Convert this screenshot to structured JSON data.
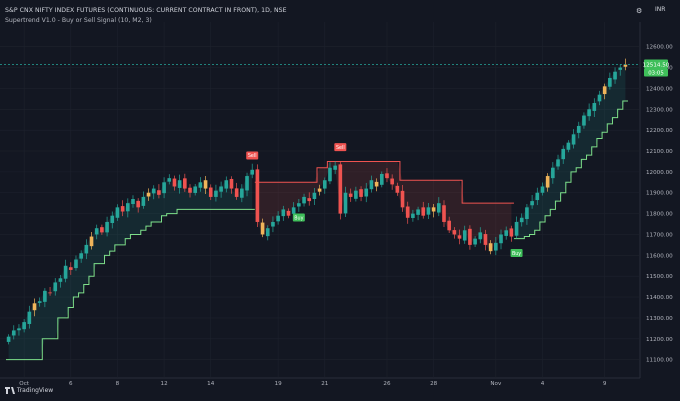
{
  "header": {
    "symbol_title": "S&P CNX NIFTY INDEX FUTURES (CONTINUOUS: CURRENT CONTRACT IN FRONT), 1D, NSE",
    "indicator_title": "Supertrend V1.0 - Buy or Sell Signal (10, M2, 3)",
    "currency": "INR",
    "settings_icon": "gear-icon"
  },
  "footer": {
    "brand": "TradingView",
    "brand_icon": "tradingview-logo-icon"
  },
  "colors": {
    "background": "#131722",
    "candle_up": "#26a69a",
    "candle_down": "#ef5350",
    "candle_highlight": "#f0b45a",
    "trend_up": "#7ee08a",
    "trend_down": "#ef5350",
    "buy_label": "#3fbf5a",
    "sell_label": "#ef5350",
    "axis_text": "#b2b5be"
  },
  "chart_data": {
    "type": "candlestick",
    "y_axis_ticks": [
      "12600.00",
      "12500.00",
      "12400.00",
      "12300.00",
      "12200.00",
      "12100.00",
      "12000.00",
      "11900.00",
      "11800.00",
      "11700.00",
      "11600.00",
      "11500.00",
      "11400.00",
      "11300.00",
      "11200.00",
      "11100.00"
    ],
    "y_axis_values": [
      12600,
      12500,
      12400,
      12300,
      12200,
      12100,
      12000,
      11900,
      11800,
      11700,
      11600,
      11500,
      11400,
      11300,
      11200,
      11100
    ],
    "ylim": [
      11060,
      12680
    ],
    "x_axis_labels": [
      {
        "text": "Oct",
        "bar": 3
      },
      {
        "text": "6",
        "bar": 12
      },
      {
        "text": "8",
        "bar": 21
      },
      {
        "text": "12",
        "bar": 30
      },
      {
        "text": "14",
        "bar": 39
      },
      {
        "text": "19",
        "bar": 52
      },
      {
        "text": "21",
        "bar": 61
      },
      {
        "text": "26",
        "bar": 73
      },
      {
        "text": "28",
        "bar": 82
      },
      {
        "text": "Nov",
        "bar": 94
      },
      {
        "text": "4",
        "bar": 103
      },
      {
        "text": "9",
        "bar": 115
      }
    ],
    "bar_count": 120,
    "closes": [
      11210,
      11240,
      11250,
      11280,
      11330,
      11370,
      11380,
      11430,
      11420,
      11470,
      11490,
      11550,
      11530,
      11580,
      11610,
      11650,
      11690,
      11730,
      11710,
      11760,
      11790,
      11830,
      11810,
      11850,
      11870,
      11830,
      11880,
      11900,
      11920,
      11890,
      11950,
      11970,
      11930,
      11960,
      11920,
      11900,
      11930,
      11950,
      11920,
      11880,
      11910,
      11930,
      11960,
      11920,
      11880,
      11920,
      11980,
      12010,
      11760,
      11700,
      11730,
      11760,
      11790,
      11820,
      11790,
      11830,
      11850,
      11880,
      11860,
      11900,
      11920,
      11960,
      12020,
      12030,
      11800,
      11900,
      11880,
      11910,
      11880,
      11920,
      11960,
      11930,
      11990,
      11970,
      11940,
      11900,
      11830,
      11780,
      11800,
      11820,
      11790,
      11830,
      11810,
      11850,
      11760,
      11720,
      11700,
      11680,
      11720,
      11650,
      11680,
      11710,
      11650,
      11620,
      11660,
      11700,
      11720,
      11690,
      11760,
      11780,
      11830,
      11860,
      11900,
      11930,
      11980,
      12020,
      12060,
      12110,
      12140,
      12180,
      12220,
      12270,
      12300,
      12330,
      12370,
      12410,
      12450,
      12480,
      12500,
      12514
    ],
    "supertrend": [
      11100,
      11100,
      11100,
      11100,
      11100,
      11100,
      11100,
      11200,
      11200,
      11200,
      11300,
      11300,
      11350,
      11400,
      11420,
      11460,
      11500,
      11560,
      11560,
      11600,
      11620,
      11650,
      11650,
      11680,
      11700,
      11700,
      11720,
      11740,
      11760,
      11760,
      11790,
      11800,
      11800,
      11820,
      11820,
      11820,
      11820,
      11820,
      11820,
      11820,
      11820,
      11820,
      11820,
      11820,
      11820,
      11820,
      11820,
      11820,
      11950,
      11950,
      11950,
      11950,
      11950,
      11950,
      11950,
      11950,
      11950,
      11950,
      11950,
      11950,
      12020,
      12020,
      12050,
      12050,
      12050,
      12050,
      12050,
      12050,
      12050,
      12050,
      12050,
      12050,
      12050,
      12050,
      12050,
      12050,
      11960,
      11960,
      11960,
      11960,
      11960,
      11960,
      11960,
      11960,
      11960,
      11960,
      11960,
      11960,
      11850,
      11850,
      11850,
      11850,
      11850,
      11850,
      11850,
      11850,
      11850,
      11850,
      11680,
      11680,
      11690,
      11700,
      11720,
      11760,
      11790,
      11820,
      11860,
      11900,
      11950,
      12000,
      12020,
      12060,
      12080,
      12120,
      12160,
      12190,
      12230,
      12260,
      12300,
      12340
    ],
    "trend": "0-47:up, 48-97:down, 98-119:up",
    "current_price": "12514.50",
    "current_price_value": 12514.5,
    "countdown": "03:05",
    "signals": [
      {
        "type": "sell",
        "label": "Sell",
        "bar": 47
      },
      {
        "type": "buy",
        "label": "Buy",
        "bar": 56
      },
      {
        "type": "sell",
        "label": "Sell",
        "bar": 64
      },
      {
        "type": "buy",
        "label": "Buy",
        "bar": 98
      }
    ]
  }
}
